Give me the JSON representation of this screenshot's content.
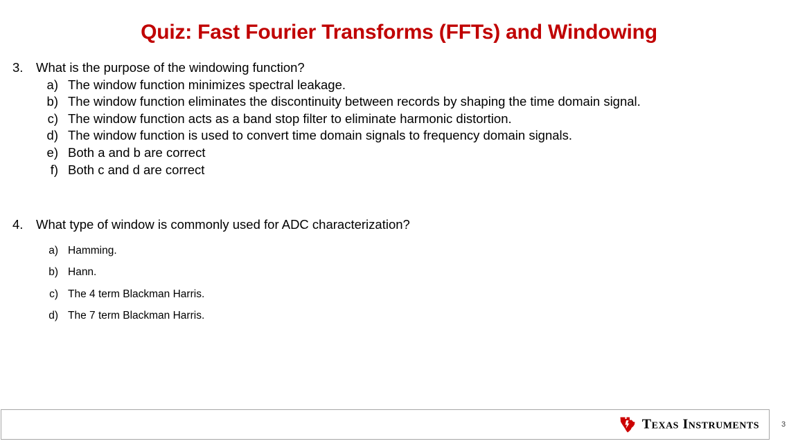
{
  "slide": {
    "title": "Quiz: Fast Fourier Transforms (FFTs) and Windowing",
    "title_color": "#C00000",
    "page_number": "3"
  },
  "questions": [
    {
      "marker": "3.",
      "text": "What is the purpose of the windowing function?",
      "options": [
        {
          "marker": "a)",
          "text": "The window function minimizes spectral leakage."
        },
        {
          "marker": "b)",
          "text": "The window function eliminates the discontinuity between records by shaping the time domain signal."
        },
        {
          "marker": "c)",
          "text": "The window function acts as a band stop filter to eliminate harmonic distortion."
        },
        {
          "marker": "d)",
          "text": "The window function is used to convert time domain signals to frequency domain signals."
        },
        {
          "marker": "e)",
          "text": "Both a and b are correct"
        },
        {
          "marker": "f)",
          "text": "Both c and d are correct"
        }
      ]
    },
    {
      "marker": "4.",
      "text": "What type of window is commonly used for ADC characterization?",
      "options": [
        {
          "marker": "a)",
          "text": "Hamming."
        },
        {
          "marker": "b)",
          "text": "Hann."
        },
        {
          "marker": "c)",
          "text": "The 4 term Blackman Harris."
        },
        {
          "marker": "d)",
          "text": "The 7 term Blackman Harris."
        }
      ]
    }
  ],
  "footer": {
    "logo_text": "Texas Instruments",
    "logo_mark_color": "#CC0000",
    "border_color": "#a6a6a6"
  }
}
